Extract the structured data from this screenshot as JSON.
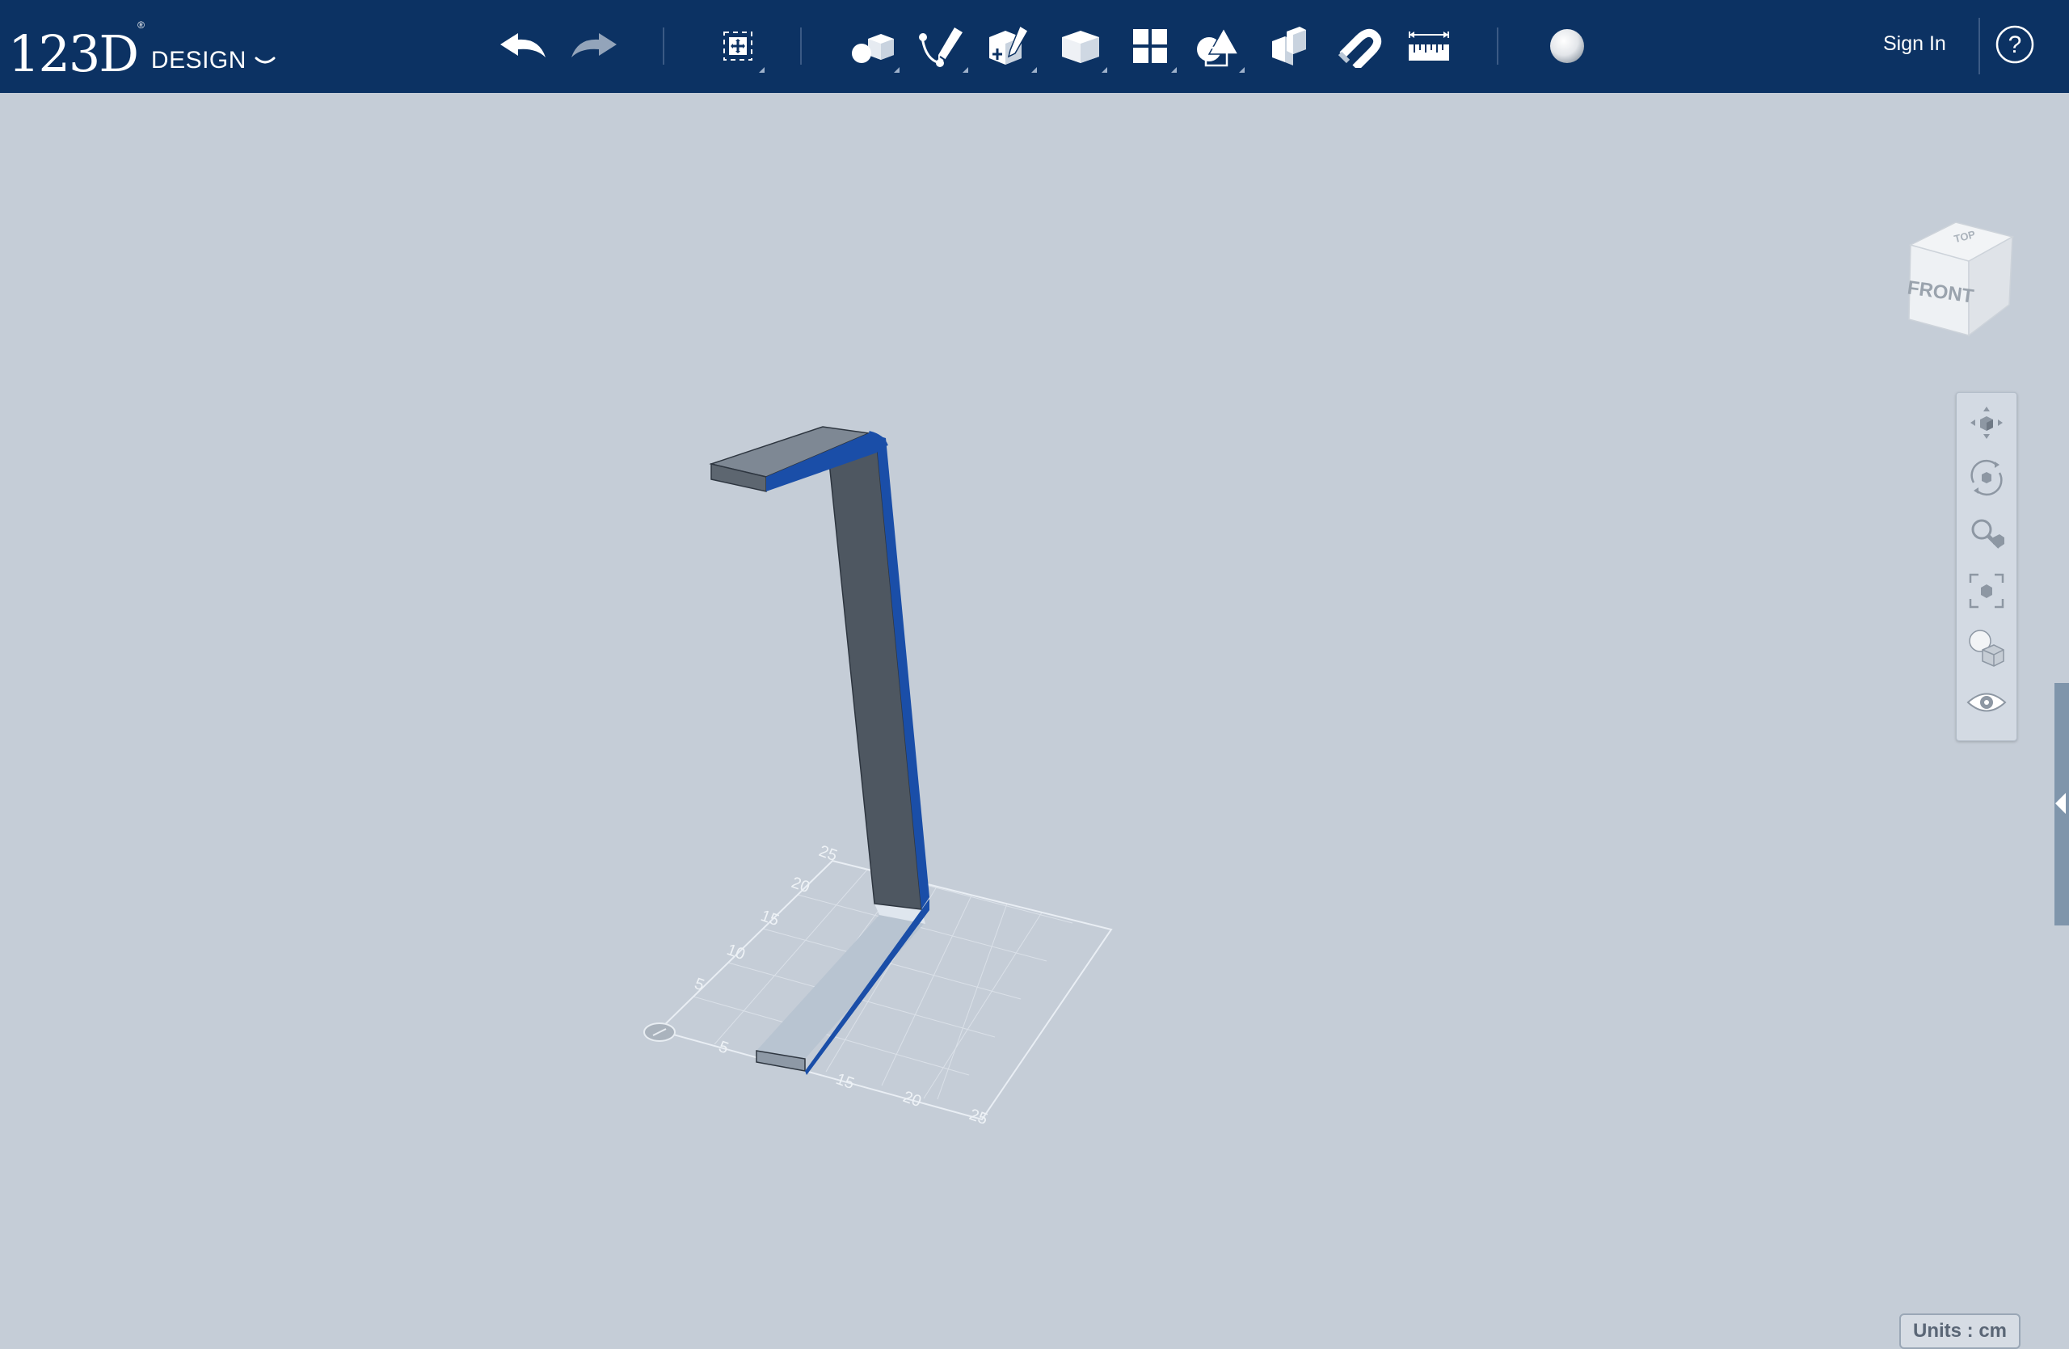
{
  "app": {
    "logo_big": "123D",
    "logo_reg": "®",
    "logo_small": "DESIGN"
  },
  "toolbar": {
    "buttons": [
      {
        "name": "undo",
        "icon": "undo-arrow-icon"
      },
      {
        "name": "redo",
        "icon": "redo-arrow-icon"
      },
      {
        "name": "transform",
        "icon": "transform-icon"
      },
      {
        "name": "primitives",
        "icon": "primitives-icon"
      },
      {
        "name": "sketch",
        "icon": "sketch-icon"
      },
      {
        "name": "construct",
        "icon": "construct-icon"
      },
      {
        "name": "modify",
        "icon": "modify-icon"
      },
      {
        "name": "pattern",
        "icon": "pattern-icon"
      },
      {
        "name": "group",
        "icon": "group-icon"
      },
      {
        "name": "combine",
        "icon": "combine-icon"
      },
      {
        "name": "snap",
        "icon": "snap-magnet-icon"
      },
      {
        "name": "measure",
        "icon": "measure-ruler-icon"
      },
      {
        "name": "material",
        "icon": "material-sphere-icon"
      }
    ],
    "sign_in": "Sign In",
    "help": "?"
  },
  "viewcube": {
    "front": "FRONT",
    "top": "TOP"
  },
  "nav": [
    "pan-icon",
    "orbit-icon",
    "zoom-icon",
    "fit-icon",
    "view-mode-icon",
    "visibility-eye-icon"
  ],
  "grid": {
    "x_ticks": [
      "5",
      "15",
      "20",
      "25"
    ],
    "y_ticks": [
      "5",
      "10",
      "15",
      "20",
      "25"
    ]
  },
  "status": {
    "units": "Units : cm"
  },
  "colors": {
    "toolbar": "#0c3263",
    "viewport": "#c5cdd7",
    "selection_edge": "#1a4ea8",
    "model_face_dark": "#4e5761",
    "model_face_light": "#b8c4d1"
  }
}
